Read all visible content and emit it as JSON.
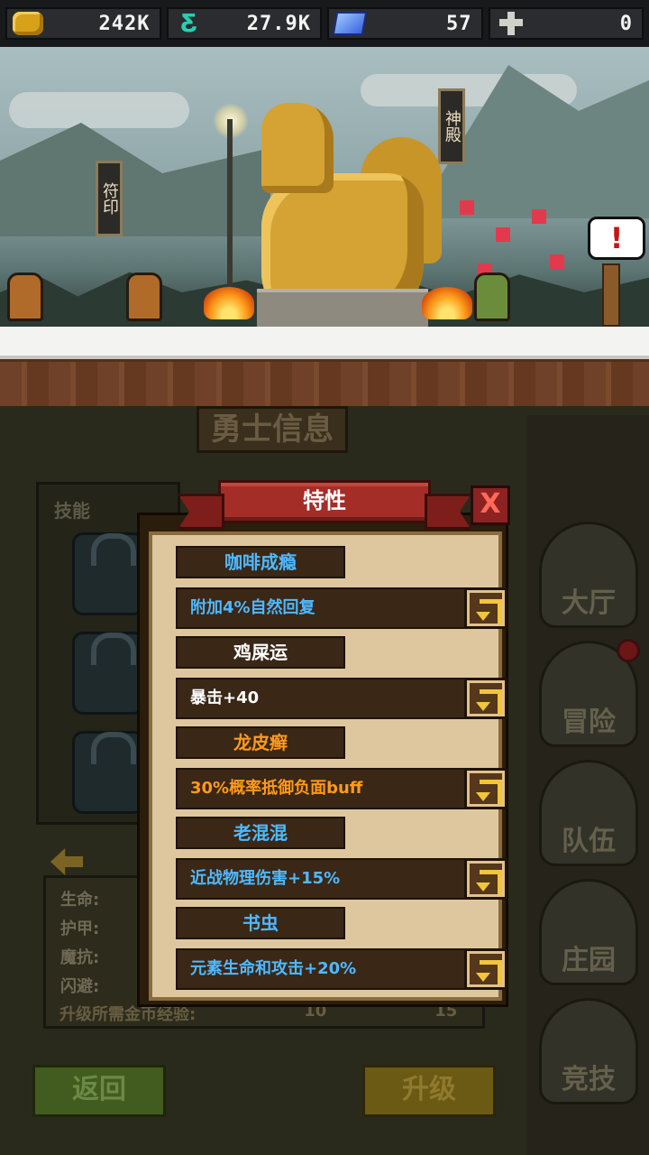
{
  "resources": [
    {
      "icon": "gold-coin-icon",
      "value": "242K"
    },
    {
      "icon": "energy-icon",
      "value": "27.9K"
    },
    {
      "icon": "gem-icon",
      "value": "57"
    },
    {
      "icon": "cross-icon",
      "value": "0"
    }
  ],
  "scene": {
    "banner_left": "符印",
    "banner_right": "神殿",
    "alert": "!"
  },
  "hero_panel": {
    "title": "勇士信息",
    "skills_label": "技能",
    "stats": [
      "生命:",
      "护甲:",
      "魔抗:",
      "闪避:"
    ],
    "upgrade_cost_label": "升级所需金币经验:",
    "cost_a": "10",
    "cost_b": "15",
    "back_label": "返回",
    "upgrade_label": "升级"
  },
  "side_nav": [
    {
      "label": "大厅"
    },
    {
      "label": "冒险"
    },
    {
      "label": "队伍"
    },
    {
      "label": "庄园"
    },
    {
      "label": "竞技"
    }
  ],
  "modal": {
    "title": "特性",
    "close": "X",
    "traits": [
      {
        "name": "咖啡成瘾",
        "desc": "附加4%自然回复",
        "name_color": "#4fb9ff",
        "desc_color": "#4fb9ff"
      },
      {
        "name": "鸡屎运",
        "desc": "暴击+40",
        "name_color": "#ffffff",
        "desc_color": "#ffffff"
      },
      {
        "name": "龙皮癣",
        "desc": "30%概率抵御负面buff",
        "name_color": "#ff9a1a",
        "desc_color": "#ff9a1a"
      },
      {
        "name": "老混混",
        "desc": "近战物理伤害+15%",
        "name_color": "#4fb9ff",
        "desc_color": "#4fb9ff"
      },
      {
        "name": "书虫",
        "desc": "元素生命和攻击+20%",
        "name_color": "#4fb9ff",
        "desc_color": "#4fb9ff"
      }
    ]
  }
}
